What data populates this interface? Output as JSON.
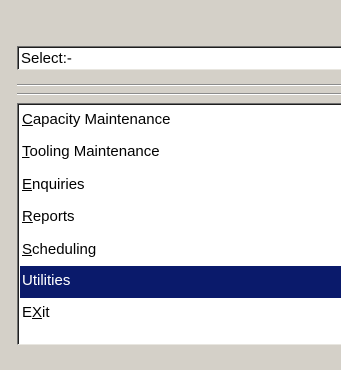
{
  "select_field": {
    "value": "Select:-"
  },
  "menu": {
    "selected_index": 5,
    "items": [
      {
        "mnemonic": "C",
        "rest": "apacity Maintenance",
        "pre": ""
      },
      {
        "mnemonic": "T",
        "rest": "ooling Maintenance",
        "pre": ""
      },
      {
        "mnemonic": "E",
        "rest": "nquiries",
        "pre": ""
      },
      {
        "mnemonic": "R",
        "rest": "eports",
        "pre": ""
      },
      {
        "mnemonic": "S",
        "rest": "cheduling",
        "pre": ""
      },
      {
        "mnemonic": "U",
        "rest": "tilities",
        "pre": "",
        "selected": true
      },
      {
        "mnemonic": "X",
        "rest": "it",
        "pre": "E"
      }
    ]
  },
  "colors": {
    "window_background": "#d4d0c8",
    "selection_background": "#0a1a6b",
    "selection_text": "#ffffff"
  }
}
